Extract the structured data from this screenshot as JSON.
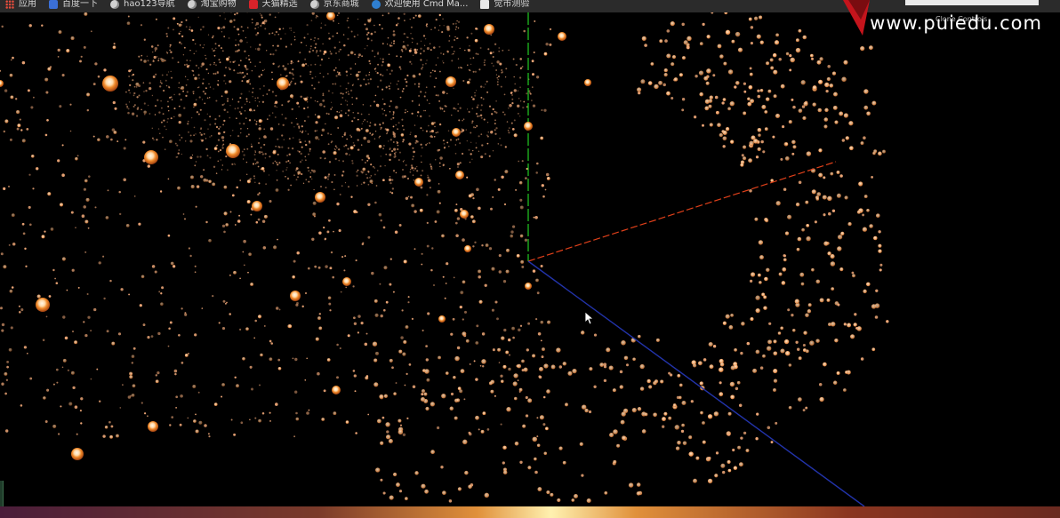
{
  "bookmarks_bar": {
    "items": [
      {
        "label": "应用",
        "icon": "apps-grid-icon"
      },
      {
        "label": "百度一下",
        "icon": "paw-icon"
      },
      {
        "label": "hao123导航",
        "icon": "globe-icon"
      },
      {
        "label": "淘宝购物",
        "icon": "globe-icon"
      },
      {
        "label": "天猫精选",
        "icon": "tmall-icon"
      },
      {
        "label": "京东商城",
        "icon": "globe-icon"
      },
      {
        "label": "欢迎使用 Cmd Ma...",
        "icon": "edge-icon"
      },
      {
        "label": "觉市测验",
        "icon": "document-icon"
      }
    ]
  },
  "watermark": {
    "url": "www.puiedu.com",
    "overlay_text": "Clone Controls"
  },
  "scene": {
    "description_colors": {
      "background": "#000000",
      "particle": "#f0a070",
      "sphere": "#e8801f",
      "axis_y": "#22cc22",
      "axis_x": "#e0401a",
      "axis_z": "#2233aa"
    }
  }
}
